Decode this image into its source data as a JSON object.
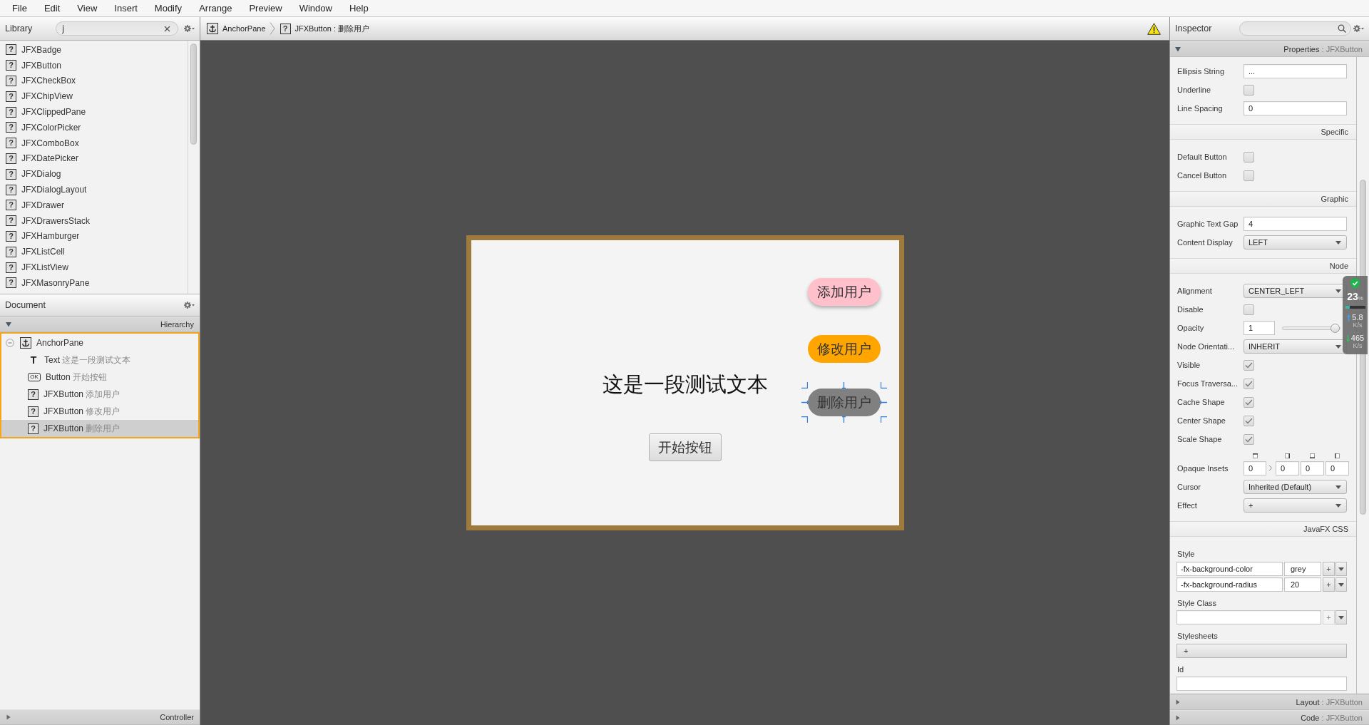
{
  "menu_bar": {
    "items": [
      "File",
      "Edit",
      "View",
      "Insert",
      "Modify",
      "Arrange",
      "Preview",
      "Window",
      "Help"
    ]
  },
  "library": {
    "title": "Library",
    "search": {
      "value": "j"
    },
    "items": [
      {
        "icon": "?",
        "name": "JFXBadge"
      },
      {
        "icon": "?",
        "name": "JFXButton"
      },
      {
        "icon": "?",
        "name": "JFXCheckBox"
      },
      {
        "icon": "?",
        "name": "JFXChipView"
      },
      {
        "icon": "?",
        "name": "JFXClippedPane"
      },
      {
        "icon": "?",
        "name": "JFXColorPicker"
      },
      {
        "icon": "?",
        "name": "JFXComboBox"
      },
      {
        "icon": "?",
        "name": "JFXDatePicker"
      },
      {
        "icon": "?",
        "name": "JFXDialog"
      },
      {
        "icon": "?",
        "name": "JFXDialogLayout"
      },
      {
        "icon": "?",
        "name": "JFXDrawer"
      },
      {
        "icon": "?",
        "name": "JFXDrawersStack"
      },
      {
        "icon": "?",
        "name": "JFXHamburger"
      },
      {
        "icon": "?",
        "name": "JFXListCell"
      },
      {
        "icon": "?",
        "name": "JFXListView"
      },
      {
        "icon": "?",
        "name": "JFXMasonryPane"
      }
    ]
  },
  "document": {
    "title": "Document",
    "hierarchy": {
      "title": "Hierarchy",
      "expanded": true,
      "tree": [
        {
          "kind": "anchor",
          "label": "AnchorPane",
          "expanded": true,
          "selected": false,
          "children": [
            {
              "kind": "text",
              "icon": "T",
              "label": "Text",
              "detail": "这是一段测试文本",
              "selected": false
            },
            {
              "kind": "button",
              "icon": "OK",
              "label": "Button",
              "detail": "开始按钮",
              "selected": false
            },
            {
              "kind": "unknown",
              "icon": "?",
              "label": "JFXButton",
              "detail": "添加用户",
              "selected": false
            },
            {
              "kind": "unknown",
              "icon": "?",
              "label": "JFXButton",
              "detail": "修改用户",
              "selected": false
            },
            {
              "kind": "unknown",
              "icon": "?",
              "label": "JFXButton",
              "detail": "删除用户",
              "selected": true
            }
          ]
        }
      ]
    },
    "controller": {
      "title": "Controller",
      "expanded": false
    }
  },
  "breadcrumb": {
    "items": [
      {
        "kind": "anchor",
        "label": "AnchorPane"
      },
      {
        "kind": "unknown",
        "icon": "?",
        "label": "JFXButton : 删除用户"
      }
    ],
    "warning": true
  },
  "canvas": {
    "text": {
      "label": "这是一段测试文本",
      "selected": false
    },
    "button": {
      "label": "开始按钮",
      "selected": false
    },
    "jfx_buttons": [
      {
        "label": "添加用户",
        "color": "#ffc0cb",
        "raised": true,
        "selected": false
      },
      {
        "label": "修改用户",
        "color": "#ffa500",
        "raised": false,
        "selected": false
      },
      {
        "label": "删除用户",
        "color": "#808080",
        "raised": false,
        "selected": true
      }
    ]
  },
  "inspector": {
    "title": "Inspector",
    "properties": {
      "title": "Properties",
      "subtitle": ": JFXButton",
      "expanded": true,
      "groups": [
        {
          "rows": [
            {
              "kind": "text",
              "label": "Ellipsis String",
              "value": "..."
            },
            {
              "kind": "checkbox",
              "label": "Underline",
              "checked": false
            },
            {
              "kind": "text",
              "label": "Line Spacing",
              "value": "0"
            }
          ]
        },
        {
          "title": "Specific",
          "rows": [
            {
              "kind": "checkbox",
              "label": "Default Button",
              "checked": false
            },
            {
              "kind": "checkbox",
              "label": "Cancel Button",
              "checked": false
            }
          ]
        },
        {
          "title": "Graphic",
          "rows": [
            {
              "kind": "text",
              "label": "Graphic Text Gap",
              "value": "4"
            },
            {
              "kind": "dropdown",
              "label": "Content Display",
              "value": "LEFT"
            }
          ]
        },
        {
          "title": "Node",
          "rows": [
            {
              "kind": "dropdown",
              "label": "Alignment",
              "value": "CENTER_LEFT"
            },
            {
              "kind": "checkbox",
              "label": "Disable",
              "checked": false
            },
            {
              "kind": "slider",
              "label": "Opacity",
              "value": "1",
              "level": 1
            },
            {
              "kind": "dropdown",
              "label": "Node Orientati...",
              "value": "INHERIT"
            },
            {
              "kind": "checkbox",
              "label": "Visible",
              "checked": true
            },
            {
              "kind": "checkbox",
              "label": "Focus Traversa...",
              "checked": true
            },
            {
              "kind": "checkbox",
              "label": "Cache Shape",
              "checked": true
            },
            {
              "kind": "checkbox",
              "label": "Center Shape",
              "checked": true
            },
            {
              "kind": "checkbox",
              "label": "Scale Shape",
              "checked": true
            },
            {
              "kind": "insets",
              "label": "Opaque Insets",
              "values": [
                "0",
                "0",
                "0",
                "0"
              ]
            },
            {
              "kind": "dropdown",
              "label": "Cursor",
              "value": "Inherited (Default)"
            },
            {
              "kind": "dropdown",
              "label": "Effect",
              "value": "+"
            }
          ]
        },
        {
          "title": "JavaFX CSS",
          "rows": [
            {
              "kind": "style_list",
              "label": "Style",
              "entries": [
                {
                  "property": "-fx-background-color",
                  "value": "grey",
                  "add": {
                    "label": "+",
                    "disabled": false
                  }
                },
                {
                  "property": "-fx-background-radius",
                  "value": "20",
                  "add": {
                    "label": "+",
                    "disabled": false
                  }
                }
              ]
            },
            {
              "kind": "style_class",
              "label": "Style Class",
              "add": {
                "label": "+",
                "disabled": true
              }
            },
            {
              "kind": "stylesheets",
              "label": "Stylesheets",
              "button": "+"
            },
            {
              "kind": "id",
              "label": "Id"
            }
          ]
        }
      ]
    },
    "layout": {
      "title": "Layout",
      "subtitle": ": JFXButton",
      "expanded": false
    },
    "code": {
      "title": "Code",
      "subtitle": ": JFXButton",
      "expanded": false
    }
  },
  "system_monitor": {
    "cpu": "23",
    "unit": "%",
    "level": 0.23,
    "upload": "5.8",
    "upload_unit": "K/s",
    "download": "465",
    "download_unit": "K/s"
  }
}
